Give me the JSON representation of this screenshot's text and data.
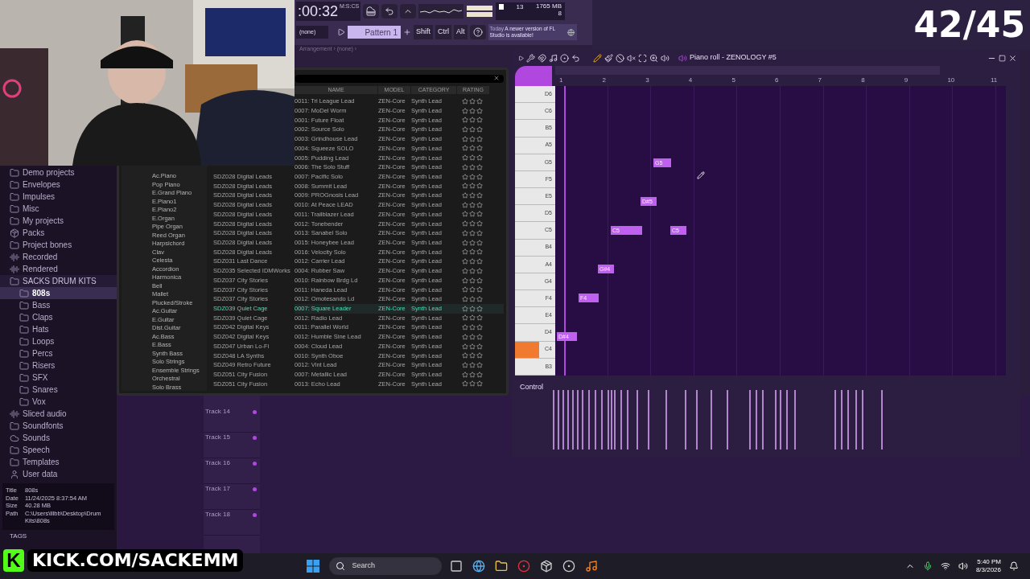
{
  "stream_overlay": {
    "counter": "42/45",
    "channel": "KICK.COM/SACKEMM",
    "logo": "K"
  },
  "toolbar": {
    "time": ":00:32",
    "time_unit": "M:S:CS",
    "pattern_picker": "(none)",
    "pattern": "Pattern 1",
    "modifiers": [
      "Shift",
      "Ctrl",
      "Alt"
    ],
    "news_day": "Today",
    "news": "A newer version of FL Studio is available!",
    "cpu": "13",
    "memory": "1765 MB",
    "polyphony": "8",
    "arrangement": "Arrangement › (none) ›"
  },
  "browser": {
    "items": [
      {
        "label": "Demo projects",
        "kind": "folder",
        "selected": false
      },
      {
        "label": "Envelopes",
        "kind": "folder",
        "selected": false
      },
      {
        "label": "Impulses",
        "kind": "folder",
        "selected": false
      },
      {
        "label": "Misc",
        "kind": "folder",
        "selected": false
      },
      {
        "label": "My projects",
        "kind": "folder",
        "selected": false
      },
      {
        "label": "Packs",
        "kind": "pack",
        "selected": false
      },
      {
        "label": "Project bones",
        "kind": "folder",
        "selected": false
      },
      {
        "label": "Recorded",
        "kind": "audio",
        "selected": false
      },
      {
        "label": "Rendered",
        "kind": "audio",
        "selected": false
      },
      {
        "label": "SACKS DRUM KITS",
        "kind": "folder",
        "selected": false,
        "expanded": true,
        "children": [
          {
            "label": "808s",
            "kind": "folder",
            "selected": true
          },
          {
            "label": "Bass",
            "kind": "folder",
            "selected": false
          },
          {
            "label": "Claps",
            "kind": "folder",
            "selected": false
          },
          {
            "label": "Hats",
            "kind": "folder",
            "selected": false
          },
          {
            "label": "Loops",
            "kind": "folder",
            "selected": false
          },
          {
            "label": "Percs",
            "kind": "folder",
            "selected": false
          },
          {
            "label": "Risers",
            "kind": "folder",
            "selected": false
          },
          {
            "label": "SFX",
            "kind": "folder",
            "selected": false
          },
          {
            "label": "Snares",
            "kind": "folder",
            "selected": false
          },
          {
            "label": "Vox",
            "kind": "folder",
            "selected": false
          }
        ]
      },
      {
        "label": "Sliced audio",
        "kind": "audio",
        "selected": false
      },
      {
        "label": "Soundfonts",
        "kind": "folder",
        "selected": false
      },
      {
        "label": "Sounds",
        "kind": "cloud",
        "selected": false
      },
      {
        "label": "Speech",
        "kind": "folder",
        "selected": false
      },
      {
        "label": "Templates",
        "kind": "folder",
        "selected": false
      },
      {
        "label": "User data",
        "kind": "user",
        "selected": false
      }
    ],
    "info": [
      {
        "key": "Title",
        "value": "808s"
      },
      {
        "key": "Date",
        "value": "11/24/2025 8:37:54 AM"
      },
      {
        "key": "Size",
        "value": "40.28 MB"
      },
      {
        "key": "Path",
        "value": "C:\\Users\\lllbb\\Desktop\\Drum Kits\\808s"
      }
    ],
    "tags": "TAGS"
  },
  "plugin": {
    "categories": [
      "Ac.Piano",
      "Pop Piano",
      "E.Grand Piano",
      "E.Piano1",
      "E.Piano2",
      "E.Organ",
      "Pipe Organ",
      "Reed Organ",
      "Harpsichord",
      "Clav",
      "Celesta",
      "Accordion",
      "Harmonica",
      "Bell",
      "Mallet",
      "Plucked/Stroke",
      "Ac.Guitar",
      "E.Guitar",
      "Dist.Guitar",
      "Ac.Bass",
      "E.Bass",
      "Synth Bass",
      "Solo Strings",
      "Ensemble Strings",
      "Orchestral",
      "Solo Brass"
    ],
    "columns": [
      "NAME",
      "MODEL",
      "CATEGORY",
      "RATING"
    ],
    "rows": [
      {
        "name": "0011: Tri League Lead",
        "model": "ZEN-Core",
        "category": "Synth Lead",
        "stars": 0,
        "selected": false
      },
      {
        "name": "0007: MoDel Worm",
        "model": "ZEN-Core",
        "category": "Synth Lead",
        "stars": 0,
        "selected": false
      },
      {
        "name": "0001: Future Float",
        "model": "ZEN-Core",
        "category": "Synth Lead",
        "stars": 0,
        "selected": false
      },
      {
        "name": "0002: Source Solo",
        "model": "ZEN-Core",
        "category": "Synth Lead",
        "stars": 0,
        "selected": false
      },
      {
        "name": "0003: Grindhouse Lead",
        "model": "ZEN-Core",
        "category": "Synth Lead",
        "stars": 0,
        "selected": false
      },
      {
        "name": "0004: Squeeze SOLO",
        "model": "ZEN-Core",
        "category": "Synth Lead",
        "stars": 0,
        "selected": false
      },
      {
        "name": "0005: Pudding Lead",
        "model": "ZEN-Core",
        "category": "Synth Lead",
        "stars": 0,
        "selected": false
      },
      {
        "name": "0006: The Solo Stuff",
        "model": "ZEN-Core",
        "category": "Synth Lead",
        "stars": 0,
        "selected": false
      },
      {
        "bank": "SDZ028 Digital Leads",
        "name": "0007: Pacific Solo",
        "model": "ZEN-Core",
        "category": "Synth Lead",
        "stars": 0,
        "selected": false
      },
      {
        "bank": "SDZ028 Digital Leads",
        "name": "0008: Summit Lead",
        "model": "ZEN-Core",
        "category": "Synth Lead",
        "stars": 0,
        "selected": false
      },
      {
        "bank": "SDZ028 Digital Leads",
        "name": "0009: PROGnosis Lead",
        "model": "ZEN-Core",
        "category": "Synth Lead",
        "stars": 0,
        "selected": false
      },
      {
        "bank": "SDZ028 Digital Leads",
        "name": "0010: At Peace LEAD",
        "model": "ZEN-Core",
        "category": "Synth Lead",
        "stars": 0,
        "selected": false
      },
      {
        "bank": "SDZ028 Digital Leads",
        "name": "0011: Trailblazer Lead",
        "model": "ZEN-Core",
        "category": "Synth Lead",
        "stars": 0,
        "selected": false
      },
      {
        "bank": "SDZ028 Digital Leads",
        "name": "0012: Tonebender",
        "model": "ZEN-Core",
        "category": "Synth Lead",
        "stars": 0,
        "selected": false
      },
      {
        "bank": "SDZ028 Digital Leads",
        "name": "0013: Sanabel Solo",
        "model": "ZEN-Core",
        "category": "Synth Lead",
        "stars": 0,
        "selected": false
      },
      {
        "bank": "SDZ028 Digital Leads",
        "name": "0015: Honeybee Lead",
        "model": "ZEN-Core",
        "category": "Synth Lead",
        "stars": 0,
        "selected": false
      },
      {
        "bank": "SDZ028 Digital Leads",
        "name": "0016: Velocity Solo",
        "model": "ZEN-Core",
        "category": "Synth Lead",
        "stars": 0,
        "selected": false
      },
      {
        "bank": "SDZ031 Last Dance",
        "name": "0012: Carrier Lead",
        "model": "ZEN-Core",
        "category": "Synth Lead",
        "stars": 0,
        "selected": false
      },
      {
        "bank": "SDZ035 Selected IDMWorks",
        "name": "0004: Rubber Saw",
        "model": "ZEN-Core",
        "category": "Synth Lead",
        "stars": 0,
        "selected": false
      },
      {
        "bank": "SDZ037 City Stories",
        "name": "0010: Rainbow Brdg Ld",
        "model": "ZEN-Core",
        "category": "Synth Lead",
        "stars": 0,
        "selected": false
      },
      {
        "bank": "SDZ037 City Stories",
        "name": "0011: Haneda Lead",
        "model": "ZEN-Core",
        "category": "Synth Lead",
        "stars": 0,
        "selected": false
      },
      {
        "bank": "SDZ037 City Stories",
        "name": "0012: Omotesando Ld",
        "model": "ZEN-Core",
        "category": "Synth Lead",
        "stars": 0,
        "selected": false
      },
      {
        "bank": "SDZ039 Quiet Cage",
        "name": "0007: Square Leader",
        "model": "ZEN-Core",
        "category": "Synth Lead",
        "stars": 0,
        "selected": true
      },
      {
        "bank": "SDZ039 Quiet Cage",
        "name": "0012: Radio Lead",
        "model": "ZEN-Core",
        "category": "Synth Lead",
        "stars": 0,
        "selected": false
      },
      {
        "bank": "SDZ042 Digital Keys",
        "name": "0011: Parallel World",
        "model": "ZEN-Core",
        "category": "Synth Lead",
        "stars": 0,
        "selected": false
      },
      {
        "bank": "SDZ042 Digital Keys",
        "name": "0012: Humble Sine Lead",
        "model": "ZEN-Core",
        "category": "Synth Lead",
        "stars": 0,
        "selected": false
      },
      {
        "bank": "SDZ047 Urban Lo-Fi",
        "name": "0004: Cloud Lead",
        "model": "ZEN-Core",
        "category": "Synth Lead",
        "stars": 0,
        "selected": false
      },
      {
        "bank": "SDZ048 LA Synths",
        "name": "0010: Synth Oboe",
        "model": "ZEN-Core",
        "category": "Synth Lead",
        "stars": 0,
        "selected": false
      },
      {
        "bank": "SDZ049 Retro Future",
        "name": "0012: Vint Lead",
        "model": "ZEN-Core",
        "category": "Synth Lead",
        "stars": 0,
        "selected": false
      },
      {
        "bank": "SDZ051 City Fusion",
        "name": "0007: Metallic Lead",
        "model": "ZEN-Core",
        "category": "Synth Lead",
        "stars": 0,
        "selected": false
      },
      {
        "bank": "SDZ051 City Fusion",
        "name": "0013: Echo Lead",
        "model": "ZEN-Core",
        "category": "Synth Lead",
        "stars": 0,
        "selected": false
      }
    ]
  },
  "piano_roll": {
    "title": "Piano roll - ZENOLOGY #5",
    "bars": [
      "1",
      "2",
      "3",
      "4",
      "5",
      "6",
      "7",
      "8",
      "9",
      "10",
      "11"
    ],
    "keys": [
      {
        "label": "D6",
        "active": false
      },
      {
        "label": "C6",
        "active": false
      },
      {
        "label": "B5",
        "active": false
      },
      {
        "label": "A5",
        "active": false
      },
      {
        "label": "G5",
        "active": false
      },
      {
        "label": "F5",
        "active": false
      },
      {
        "label": "E5",
        "active": false
      },
      {
        "label": "D5",
        "active": false
      },
      {
        "label": "C5",
        "active": false
      },
      {
        "label": "B4",
        "active": false
      },
      {
        "label": "A4",
        "active": false
      },
      {
        "label": "G4",
        "active": false
      },
      {
        "label": "F4",
        "active": false
      },
      {
        "label": "E4",
        "active": false
      },
      {
        "label": "D4",
        "active": false
      },
      {
        "label": "C4",
        "active": true
      },
      {
        "label": "B3",
        "active": false
      }
    ],
    "notes": [
      {
        "label": "G5"
      },
      {
        "label": "D#5"
      },
      {
        "label": "C5"
      },
      {
        "label": "C5"
      },
      {
        "label": "G#4"
      },
      {
        "label": "F4"
      },
      {
        "label": "D#4"
      }
    ],
    "control_lane": "Control"
  },
  "playlist": {
    "tracks": [
      "Track 14",
      "Track 15",
      "Track 16",
      "Track 17",
      "Track 18"
    ]
  },
  "taskbar": {
    "search": "Search",
    "time": "5:40 PM",
    "date": "8/3/2026"
  }
}
